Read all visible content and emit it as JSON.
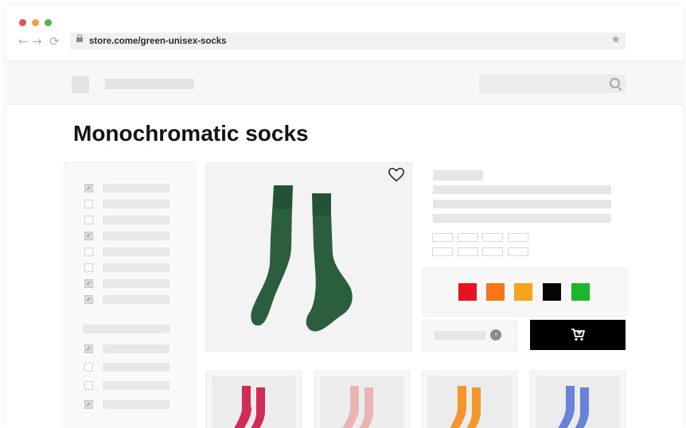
{
  "browser": {
    "url": "store.come/green-unisex-socks",
    "dots": [
      "#e0525a",
      "#f0a23a",
      "#4cbb4c"
    ],
    "back_icon": "←",
    "forward_icon": "→",
    "reload_icon": "⟳",
    "star_icon": "★"
  },
  "page": {
    "title": "Monochromatic socks"
  },
  "filters": {
    "checked": [
      true,
      false,
      false,
      true,
      false,
      false,
      true,
      true
    ],
    "section2_checked": [
      true,
      false,
      false,
      true
    ],
    "check_mark": "✓"
  },
  "product": {
    "main_color": "#2a5e3e",
    "swatches": [
      "#e8131e",
      "#f77718",
      "#f7a41d",
      "#050505",
      "#1db52a"
    ],
    "thumbnail_colors": [
      "#cf2d55",
      "#ebb4b4",
      "#f4962b",
      "#6a82d8"
    ],
    "qty_icon": "‹"
  }
}
